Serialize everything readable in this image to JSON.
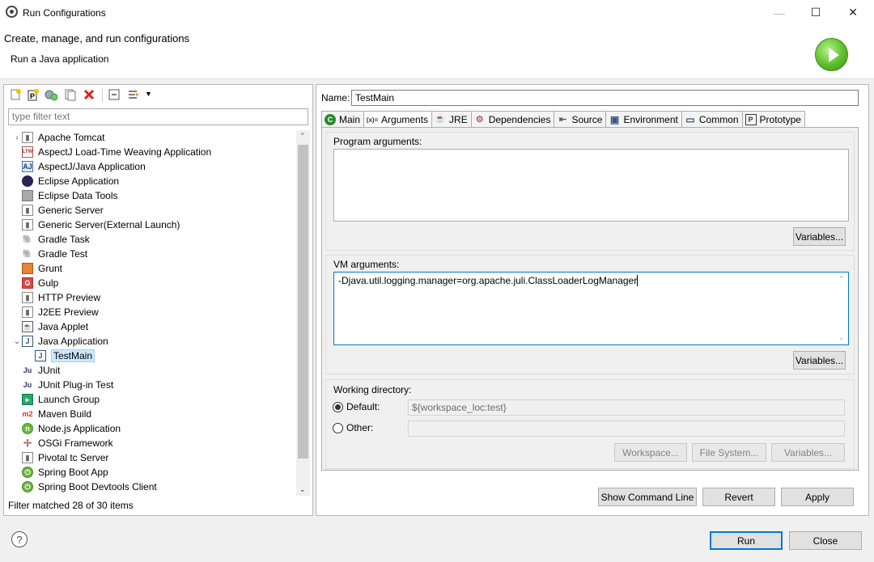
{
  "window": {
    "title": "Run Configurations",
    "minimize_glyph": "—",
    "maximize_glyph": "☐",
    "close_glyph": "✕"
  },
  "banner": {
    "title": "Create, manage, and run configurations",
    "subtitle": "Run a Java application"
  },
  "left": {
    "filter_placeholder": "type filter text",
    "status": "Filter matched 28 of 30 items",
    "tree": [
      {
        "label": "Apache Tomcat",
        "icon": "tomcat-icon",
        "expander": ">"
      },
      {
        "label": "AspectJ Load-Time Weaving Application",
        "icon": "ltw-icon"
      },
      {
        "label": "AspectJ/Java Application",
        "icon": "aj-icon"
      },
      {
        "label": "Eclipse Application",
        "icon": "eclipse-icon"
      },
      {
        "label": "Eclipse Data Tools",
        "icon": "database-icon"
      },
      {
        "label": "Generic Server",
        "icon": "server-icon"
      },
      {
        "label": "Generic Server(External Launch)",
        "icon": "server-icon"
      },
      {
        "label": "Gradle Task",
        "icon": "gradle-icon"
      },
      {
        "label": "Gradle Test",
        "icon": "gradle-icon"
      },
      {
        "label": "Grunt",
        "icon": "grunt-icon"
      },
      {
        "label": "Gulp",
        "icon": "gulp-icon"
      },
      {
        "label": "HTTP Preview",
        "icon": "server-icon"
      },
      {
        "label": "J2EE Preview",
        "icon": "server-icon"
      },
      {
        "label": "Java Applet",
        "icon": "applet-icon"
      },
      {
        "label": "Java Application",
        "icon": "java-app-icon",
        "expander": "v"
      },
      {
        "label": "TestMain",
        "icon": "java-app-icon",
        "child": true,
        "selected": true
      },
      {
        "label": "JUnit",
        "icon": "junit-icon"
      },
      {
        "label": "JUnit Plug-in Test",
        "icon": "junit-icon"
      },
      {
        "label": "Launch Group",
        "icon": "launch-group-icon"
      },
      {
        "label": "Maven Build",
        "icon": "maven-icon"
      },
      {
        "label": "Node.js Application",
        "icon": "nodejs-icon"
      },
      {
        "label": "OSGi Framework",
        "icon": "osgi-icon"
      },
      {
        "label": "Pivotal tc Server",
        "icon": "server-icon"
      },
      {
        "label": "Spring Boot App",
        "icon": "spring-icon"
      },
      {
        "label": "Spring Boot Devtools Client",
        "icon": "spring-icon"
      }
    ]
  },
  "right": {
    "name_label": "Name:",
    "name_value": "TestMain",
    "tabs": [
      {
        "label": "Main",
        "icon": "main-tab-icon"
      },
      {
        "label": "Arguments",
        "icon": "arguments-tab-icon",
        "active": true
      },
      {
        "label": "JRE",
        "icon": "jre-tab-icon"
      },
      {
        "label": "Dependencies",
        "icon": "dependencies-tab-icon"
      },
      {
        "label": "Source",
        "icon": "source-tab-icon"
      },
      {
        "label": "Environment",
        "icon": "environment-tab-icon"
      },
      {
        "label": "Common",
        "icon": "common-tab-icon"
      },
      {
        "label": "Prototype",
        "icon": "prototype-tab-icon"
      }
    ],
    "program_args_label": "Program arguments:",
    "program_args_value": "",
    "variables_btn": "Variables...",
    "vm_args_label": "VM arguments:",
    "vm_args_value": "-Djava.util.logging.manager=org.apache.juli.ClassLoaderLogManager",
    "working_dir_label": "Working directory:",
    "default_label": "Default:",
    "default_value": "${workspace_loc:test}",
    "other_label": "Other:",
    "workspace_btn": "Workspace...",
    "filesystem_btn": "File System...",
    "variables_btn2": "Variables..."
  },
  "buttons": {
    "show_command_line": "Show Command Line",
    "revert": "Revert",
    "apply": "Apply",
    "run": "Run",
    "close": "Close"
  },
  "help_glyph": "?"
}
